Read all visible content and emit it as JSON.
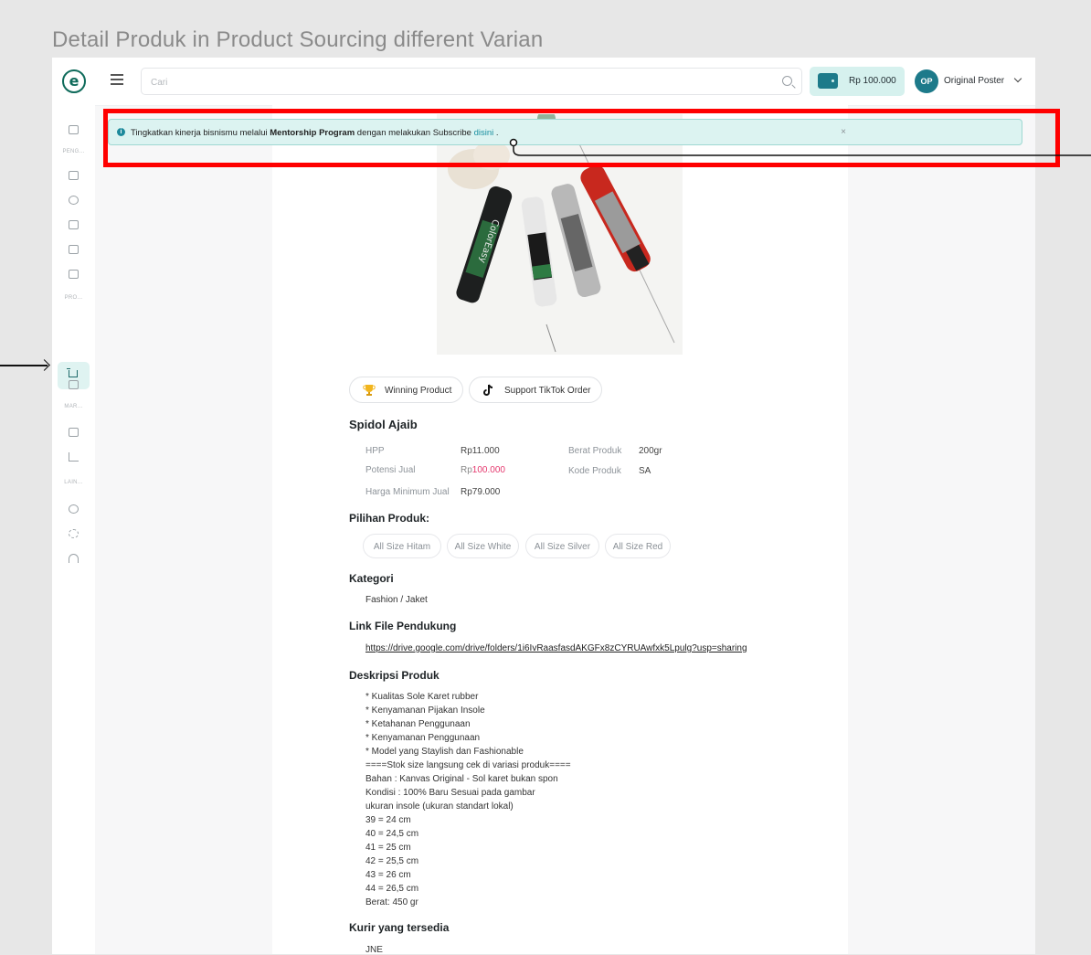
{
  "frame_title": "Detail Produk in Product Sourcing different Varian",
  "topbar": {
    "logo_char": "e",
    "search_placeholder": "Cari",
    "wallet_amount": "Rp 100.000",
    "avatar_initials": "OP",
    "username": "Original Poster"
  },
  "sidebar": {
    "labels": [
      "PENG...",
      "PRO...",
      "MAR...",
      "LAIN..."
    ]
  },
  "banner": {
    "text_before": "Tingkatkan kinerja bisnismu melalui ",
    "bold": "Mentorship Program",
    "text_middle": " dengan melakukan Subscribe ",
    "link": "disini",
    "text_after": " .",
    "close": "×"
  },
  "product": {
    "tags": [
      "Winning Product",
      "Support TikTok Order"
    ],
    "name": "Spidol Ajaib",
    "details": {
      "hpp_label": "HPP",
      "hpp_value": "Rp11.000",
      "potensi_label": "Potensi Jual",
      "potensi_prefix": "Rp",
      "potensi_value": "100.000",
      "harga_min_label": "Harga Minimum Jual",
      "harga_min_value": "Rp79.000",
      "berat_label": "Berat Produk",
      "berat_value": "200gr",
      "kode_label": "Kode Produk",
      "kode_value": "SA"
    },
    "variants_title": "Pilihan Produk:",
    "variants": [
      "All Size Hitam",
      "All Size White",
      "All Size Silver",
      "All Size Red"
    ],
    "category_title": "Kategori",
    "category": "Fashion / Jaket",
    "link_title": "Link File Pendukung",
    "link_url": "https://drive.google.com/drive/folders/1i6IvRaasfasdAKGFx8zCYRUAwfxk5Lpulg?usp=sharing",
    "desc_title": "Deskripsi Produk",
    "description": [
      "* Kualitas Sole Karet rubber",
      "* Kenyamanan Pijakan Insole",
      "* Ketahanan Penggunaan",
      "* Kenyamanan Penggunaan",
      "* Model yang Staylish dan Fashionable",
      "====Stok size langsung cek di variasi produk====",
      "Bahan : Kanvas Original - Sol karet bukan spon",
      "Kondisi : 100% Baru Sesuai pada gambar",
      "ukuran insole (ukuran standart lokal)",
      "39 = 24 cm",
      "40 = 24,5 cm",
      "41 = 25 cm",
      "42 = 25,5 cm",
      "43 = 26 cm",
      "44 = 26,5 cm",
      "Berat: 450 gr"
    ],
    "courier_title": "Kurir yang tersedia",
    "courier_first": "JNE"
  }
}
